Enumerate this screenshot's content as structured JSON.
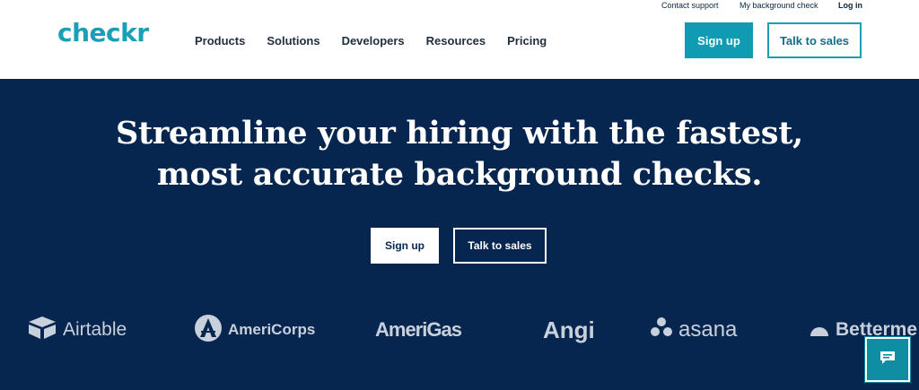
{
  "utility_nav": {
    "contact_support": "Contact support",
    "my_background_check": "My background check",
    "log_in": "Log in"
  },
  "logo": {
    "text": "checkr"
  },
  "nav": {
    "items": [
      "Products",
      "Solutions",
      "Developers",
      "Resources",
      "Pricing"
    ]
  },
  "header_buttons": {
    "sign_up": "Sign up",
    "talk_to_sales": "Talk to sales"
  },
  "hero": {
    "headline_line1": "Streamline your hiring with the fastest,",
    "headline_line2": "most accurate background checks.",
    "sign_up": "Sign up",
    "talk_to_sales": "Talk to sales"
  },
  "customer_logos": [
    "Airtable",
    "AmeriCorps",
    "AmeriGas",
    "Angi",
    "asana",
    "Betterme"
  ],
  "colors": {
    "brand_teal": "#1a9fb6",
    "hero_navy": "#06264f",
    "logo_gray": "#c8d0dc"
  },
  "chat": {
    "icon": "chat-bubble-icon"
  }
}
